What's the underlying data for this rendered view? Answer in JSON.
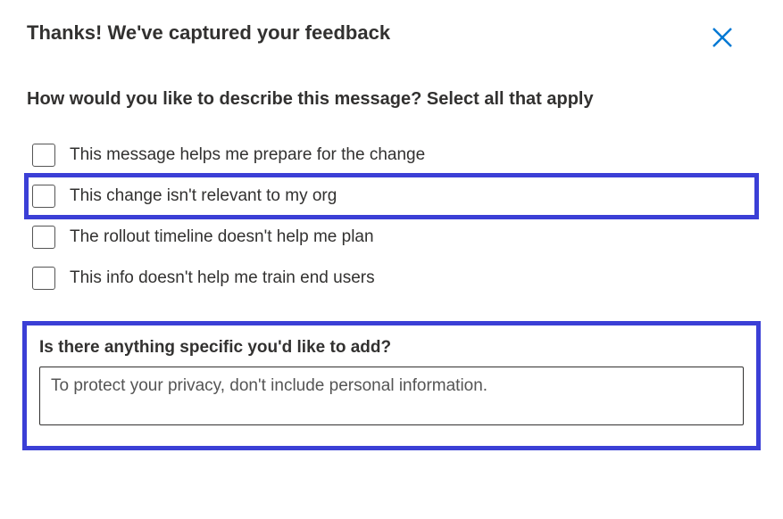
{
  "header": {
    "title": "Thanks! We've captured your feedback"
  },
  "question": "How would you like to describe this message? Select all that apply",
  "options": [
    {
      "label": "This message helps me prepare for the change",
      "highlighted": false
    },
    {
      "label": "This change isn't relevant to my org",
      "highlighted": true
    },
    {
      "label": "The rollout timeline doesn't help me plan",
      "highlighted": false
    },
    {
      "label": "This info doesn't help me train end users",
      "highlighted": false
    }
  ],
  "freeform": {
    "question": "Is there anything specific you'd like to add?",
    "placeholder": "To protect your privacy, don't include personal information.",
    "value": ""
  },
  "colors": {
    "highlight": "#3b3fd6",
    "close_icon": "#0078d4"
  }
}
